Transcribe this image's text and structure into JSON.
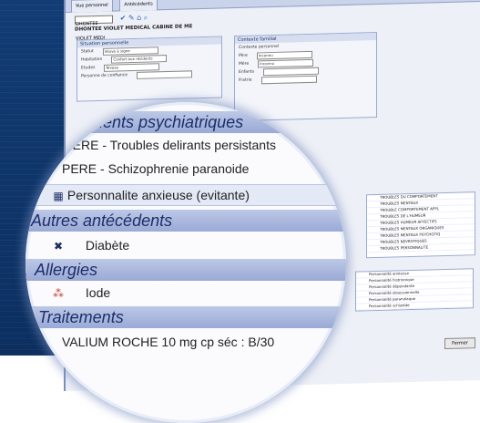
{
  "window": {
    "tabs": [
      "Vue personnel",
      "Antécédents"
    ],
    "patient_name": "DHONTEE VIOLET MEDICAL CABINE DE ME",
    "toolbar_select": "DHONTEE VIOLET MEDI"
  },
  "left_group": {
    "title": "Situation personnelle",
    "rows": [
      {
        "label": "Statut",
        "value": "Veuve à signe"
      },
      {
        "label": "Habitation",
        "value": "Confort aux résidents"
      },
      {
        "label": "Etudes",
        "value": "Niveau"
      },
      {
        "label": "Personne de confiance",
        "value": ""
      }
    ]
  },
  "right_group": {
    "title": "Contexte familial",
    "subtitle": "Contexte personnel",
    "rows": [
      {
        "label": "Père",
        "value": "Inconnu"
      },
      {
        "label": "Mère",
        "value": "Inconnu"
      },
      {
        "label": "Enfants",
        "value": ""
      },
      {
        "label": "Fratrie",
        "value": ""
      }
    ]
  },
  "right_list": [
    "TROUBLES DU COMPORTEMENT",
    "TROUBLES MENTAUX",
    "TROUBLE COMPORTEMENT APPL",
    "TROUBLES DE L'HUMEUR",
    "TROUBLES HUMEUR AFFECTIFS",
    "TROUBLES MENTAUX ORGANIQUES",
    "TROUBLES MENTAUX PSYCHOTIQ",
    "TROUBLES NEVROTIQUES",
    "TROUBLES PERSONNALITE"
  ],
  "lower_list": [
    "Personnalité anxieuse",
    "Personnalité histrionique",
    "Personnalité dépendante",
    "Personnalité obsessionnelle",
    "Personnalité paranoïaque",
    "Personnalité schizoïde"
  ],
  "close_button": "Fermer",
  "magnifier": {
    "section_psy": "...dents psychiatriques",
    "psy_items": [
      "MERE - Troubles delirants persistants",
      "PERE - Schizophrenie paranoide",
      "Personnalite anxieuse (evitante)"
    ],
    "section_other": "Autres antécédents",
    "other_items": [
      "Diabète"
    ],
    "section_allergies": "Allergies",
    "allergy_items": [
      "Iode"
    ],
    "section_treatments": "Traitements",
    "treatment_items": [
      "VALIUM ROCHE 10 mg cp séc : B/30"
    ]
  }
}
